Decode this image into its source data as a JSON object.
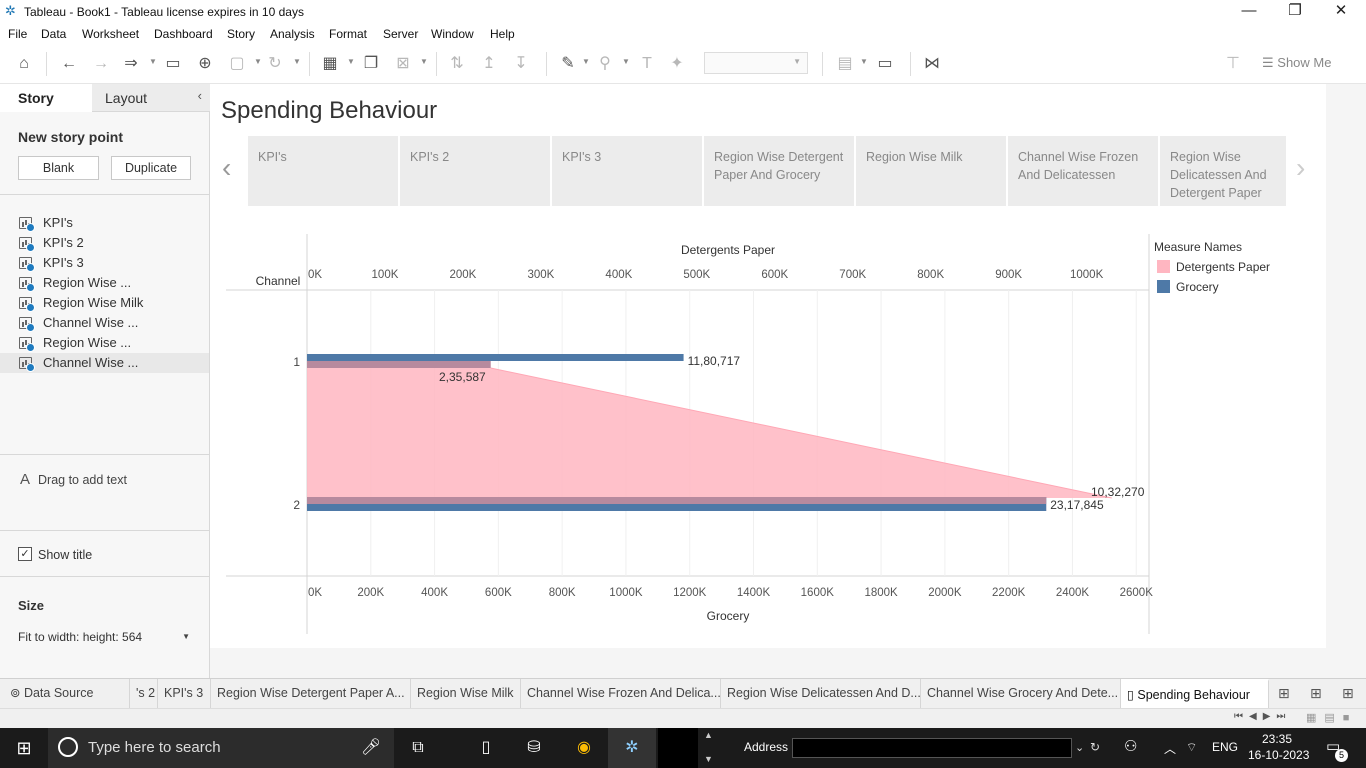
{
  "window": {
    "title": "Tableau - Book1 - Tableau license expires in 10 days",
    "minimize": "—",
    "restore": "❐",
    "close": "✕"
  },
  "menu": [
    "File",
    "Data",
    "Worksheet",
    "Dashboard",
    "Story",
    "Analysis",
    "Format",
    "Server",
    "Window",
    "Help"
  ],
  "toolbar": {
    "show_me": "Show Me"
  },
  "left_pane": {
    "tab_story": "Story",
    "tab_layout": "Layout",
    "new_story_point": "New story point",
    "btn_blank": "Blank",
    "btn_duplicate": "Duplicate",
    "story_points": [
      "KPI's",
      "KPI's 2",
      "KPI's 3",
      "Region Wise ...",
      "Region Wise Milk",
      "Channel Wise ...",
      "Region Wise ...",
      "Channel Wise ..."
    ],
    "drag_text": "Drag to add text",
    "show_title": "Show title",
    "size_label": "Size",
    "size_value": "Fit to width: height: 564"
  },
  "story": {
    "title": "Spending Behaviour",
    "cards": [
      "KPI's",
      "KPI's 2",
      "KPI's 3",
      "Region Wise Detergent Paper And Grocery",
      "Region Wise Milk",
      "Channel Wise Frozen And Delicatessen",
      "Region Wise Delicatessen And Detergent Paper"
    ]
  },
  "chart_data": {
    "type": "bar",
    "row_header": "Channel",
    "categories": [
      "1",
      "2"
    ],
    "series": [
      {
        "name": "Detergents Paper",
        "values": [
          235587,
          1032270
        ],
        "color": "#ffb6c1"
      },
      {
        "name": "Grocery",
        "values": [
          1180717,
          2317845
        ],
        "color": "#4e79a7"
      }
    ],
    "data_labels": {
      "Detergents Paper": [
        "2,35,587",
        "10,32,270"
      ],
      "Grocery": [
        "11,80,717",
        "23,17,845"
      ]
    },
    "top_axis": {
      "label": "Detergents Paper",
      "ticks": [
        "0K",
        "100K",
        "200K",
        "300K",
        "400K",
        "500K",
        "600K",
        "700K",
        "800K",
        "900K",
        "1000K"
      ],
      "range": [
        0,
        1080000
      ]
    },
    "bottom_axis": {
      "label": "Grocery",
      "ticks": [
        "0K",
        "200K",
        "400K",
        "600K",
        "800K",
        "1000K",
        "1200K",
        "1400K",
        "1600K",
        "1800K",
        "2000K",
        "2200K",
        "2400K",
        "2600K"
      ],
      "range": [
        0,
        2640000
      ]
    },
    "legend": {
      "title": "Measure Names",
      "position": "right"
    },
    "grid": true
  },
  "sheet_tabs": {
    "data_source": "Data Source",
    "tabs": [
      "'s 2",
      "KPI's 3",
      "Region Wise Detergent Paper A...",
      "Region Wise Milk",
      "Channel Wise Frozen And Delica...",
      "Region Wise Delicatessen And D...",
      "Channel Wise Grocery And Dete...",
      "Spending Behaviour"
    ]
  },
  "taskbar": {
    "search_placeholder": "Type here to search",
    "address": "Address",
    "lang": "ENG",
    "time": "23:35",
    "date": "16-10-2023",
    "notif": "5"
  }
}
